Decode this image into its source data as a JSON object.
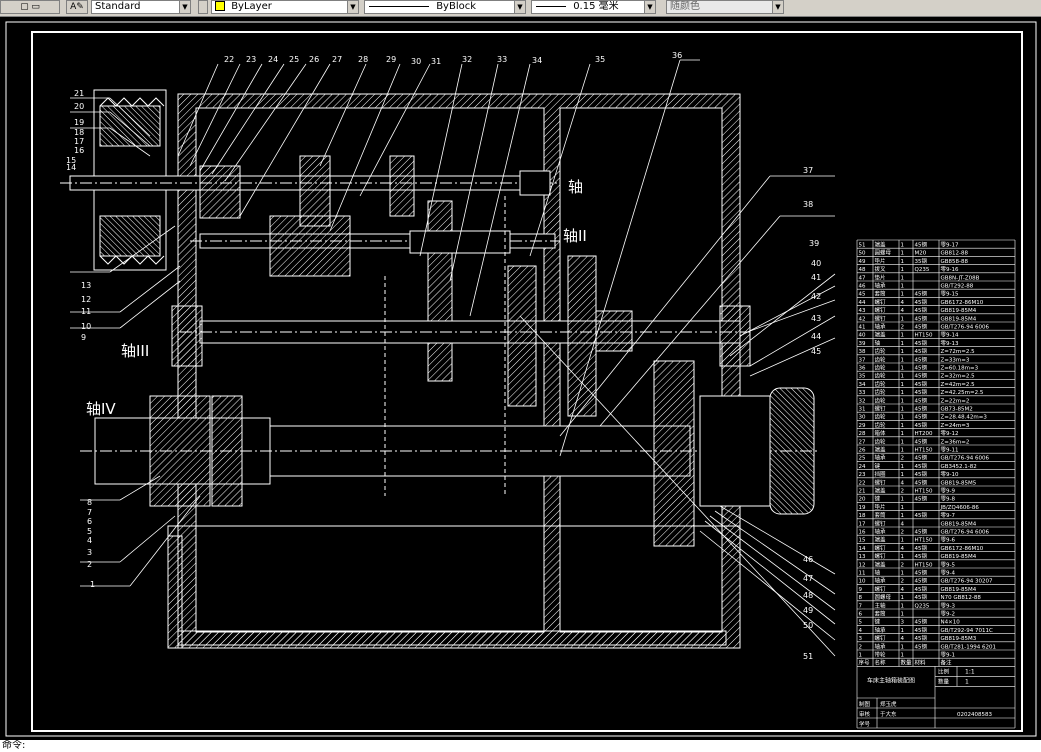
{
  "toolbar": {
    "textstyle": "Standard",
    "layer": "ByLayer",
    "linetype": "ByBlock",
    "lineweight": "0.15 毫米",
    "plotstyle": "随颜色"
  },
  "drawing": {
    "shaft_labels": {
      "I": "轴",
      "II": "轴II",
      "III": "轴III",
      "IV": "轴IV"
    },
    "callouts_top": [
      "22",
      "23",
      "24",
      "25",
      "26",
      "27",
      "28",
      "29",
      "30",
      "31",
      "32",
      "33",
      "34",
      "35",
      "36"
    ],
    "callouts_left": [
      "21",
      "20",
      "19",
      "18",
      "17",
      "16",
      "15",
      "14",
      "13",
      "12",
      "11",
      "10",
      "9",
      "8",
      "7",
      "6",
      "5",
      "4",
      "3",
      "2",
      "1"
    ],
    "callouts_right": [
      "37",
      "38",
      "39",
      "40",
      "41",
      "42",
      "43",
      "44",
      "45",
      "46",
      "47",
      "48",
      "49",
      "50",
      "51"
    ]
  },
  "parts_table": {
    "rows": [
      {
        "no": "51",
        "name": "端盖",
        "qty": "1",
        "mat": "45钢",
        "std": "零9-17"
      },
      {
        "no": "50",
        "name": "圆螺母",
        "qty": "1",
        "mat": "M20",
        "std": "GB812-88"
      },
      {
        "no": "49",
        "name": "垫片",
        "qty": "1",
        "mat": "35钢",
        "std": "GB858-88"
      },
      {
        "no": "48",
        "name": "拨叉",
        "qty": "1",
        "mat": "Q235",
        "std": "零9-16"
      },
      {
        "no": "47",
        "name": "垫片",
        "qty": "1",
        "mat": "",
        "std": "GB8N-JT-Z08B"
      },
      {
        "no": "46",
        "name": "轴承",
        "qty": "1",
        "mat": "",
        "std": "GB/T292-88"
      },
      {
        "no": "45",
        "name": "套筒",
        "qty": "1",
        "mat": "45钢",
        "std": "零9-15"
      },
      {
        "no": "44",
        "name": "螺钉",
        "qty": "4",
        "mat": "45钢",
        "std": "GB6172-86M10"
      },
      {
        "no": "43",
        "name": "螺钉",
        "qty": "4",
        "mat": "45钢",
        "std": "GB819-85M4"
      },
      {
        "no": "42",
        "name": "螺钉",
        "qty": "1",
        "mat": "45钢",
        "std": "GB819-85M4"
      },
      {
        "no": "41",
        "name": "轴承",
        "qty": "2",
        "mat": "45钢",
        "std": "GB/T276-94 6006"
      },
      {
        "no": "40",
        "name": "端盖",
        "qty": "1",
        "mat": "HT150",
        "std": "零9-14"
      },
      {
        "no": "39",
        "name": "轴",
        "qty": "1",
        "mat": "45钢",
        "std": "零9-13"
      },
      {
        "no": "38",
        "name": "齿轮",
        "qty": "1",
        "mat": "45钢",
        "std": "Z=72m=2.5"
      },
      {
        "no": "37",
        "name": "齿轮",
        "qty": "1",
        "mat": "45钢",
        "std": "Z=33m=3"
      },
      {
        "no": "36",
        "name": "齿轮",
        "qty": "1",
        "mat": "45钢",
        "std": "Z=60.18m=3"
      },
      {
        "no": "35",
        "name": "齿轮",
        "qty": "1",
        "mat": "45钢",
        "std": "Z=32m=2.5"
      },
      {
        "no": "34",
        "name": "齿轮",
        "qty": "1",
        "mat": "45钢",
        "std": "Z=42m=2.5"
      },
      {
        "no": "33",
        "name": "齿轮",
        "qty": "1",
        "mat": "45钢",
        "std": "Z=42.25m=2.5"
      },
      {
        "no": "32",
        "name": "齿轮",
        "qty": "1",
        "mat": "45钢",
        "std": "Z=22m=2"
      },
      {
        "no": "31",
        "name": "螺钉",
        "qty": "1",
        "mat": "45钢",
        "std": "GB73-85M2"
      },
      {
        "no": "30",
        "name": "齿轮",
        "qty": "1",
        "mat": "45钢",
        "std": "Z=28.48.42m=3"
      },
      {
        "no": "29",
        "name": "齿轮",
        "qty": "1",
        "mat": "45钢",
        "std": "Z=24m=3"
      },
      {
        "no": "28",
        "name": "箱体",
        "qty": "1",
        "mat": "HT200",
        "std": "零9-12"
      },
      {
        "no": "27",
        "name": "齿轮",
        "qty": "1",
        "mat": "45钢",
        "std": "Z=36m=2"
      },
      {
        "no": "26",
        "name": "端盖",
        "qty": "1",
        "mat": "HT150",
        "std": "零9-11"
      },
      {
        "no": "25",
        "name": "轴承",
        "qty": "2",
        "mat": "45钢",
        "std": "GB/T276-94 6006"
      },
      {
        "no": "24",
        "name": "键",
        "qty": "1",
        "mat": "45钢",
        "std": "GB3452.1-82"
      },
      {
        "no": "23",
        "name": "挡圈",
        "qty": "1",
        "mat": "45钢",
        "std": "零9-10"
      },
      {
        "no": "22",
        "name": "螺钉",
        "qty": "4",
        "mat": "45钢",
        "std": "GB819-85M5"
      },
      {
        "no": "21",
        "name": "端盖",
        "qty": "2",
        "mat": "HT150",
        "std": "零9-9"
      },
      {
        "no": "20",
        "name": "键",
        "qty": "1",
        "mat": "45钢",
        "std": "零9-8"
      },
      {
        "no": "19",
        "name": "垫片",
        "qty": "1",
        "mat": "",
        "std": "JB/ZQ4606-86"
      },
      {
        "no": "18",
        "name": "套筒",
        "qty": "1",
        "mat": "45钢",
        "std": "零9-7"
      },
      {
        "no": "17",
        "name": "螺钉",
        "qty": "4",
        "mat": "",
        "std": "GB819-85M4"
      },
      {
        "no": "16",
        "name": "轴承",
        "qty": "2",
        "mat": "45钢",
        "std": "GB/T276-94 6006"
      },
      {
        "no": "15",
        "name": "端盖",
        "qty": "1",
        "mat": "HT150",
        "std": "零9-6"
      },
      {
        "no": "14",
        "name": "螺钉",
        "qty": "4",
        "mat": "45钢",
        "std": "GB6172-86M10"
      },
      {
        "no": "13",
        "name": "螺钉",
        "qty": "1",
        "mat": "45钢",
        "std": "GB819-85M4"
      },
      {
        "no": "12",
        "name": "端盖",
        "qty": "2",
        "mat": "HT150",
        "std": "零9-5"
      },
      {
        "no": "11",
        "name": "轴",
        "qty": "1",
        "mat": "45钢",
        "std": "零9-4"
      },
      {
        "no": "10",
        "name": "轴承",
        "qty": "2",
        "mat": "45钢",
        "std": "GB/T276-94 30207"
      },
      {
        "no": "9",
        "name": "螺钉",
        "qty": "4",
        "mat": "45钢",
        "std": "GB819-85M4"
      },
      {
        "no": "8",
        "name": "圆螺母",
        "qty": "1",
        "mat": "45钢",
        "std": "N70 GB812-88"
      },
      {
        "no": "7",
        "name": "主轴",
        "qty": "1",
        "mat": "Q235",
        "std": "零9-3"
      },
      {
        "no": "6",
        "name": "套筒",
        "qty": "1",
        "mat": "",
        "std": "零9-2"
      },
      {
        "no": "5",
        "name": "键",
        "qty": "3",
        "mat": "45钢",
        "std": "N4×10"
      },
      {
        "no": "4",
        "name": "轴承",
        "qty": "1",
        "mat": "45钢",
        "std": "GB/T292-94 7011C"
      },
      {
        "no": "3",
        "name": "螺钉",
        "qty": "4",
        "mat": "45钢",
        "std": "GB819-85M3"
      },
      {
        "no": "2",
        "name": "轴承",
        "qty": "1",
        "mat": "45钢",
        "std": "GB/T281-1994 6201"
      },
      {
        "no": "1",
        "name": "带轮",
        "qty": "1",
        "mat": "",
        "std": "零9-1"
      }
    ],
    "header": {
      "no": "序号",
      "name": "名称",
      "qty": "数量",
      "mat": "材料",
      "std": "备注"
    },
    "title_block": {
      "title": "车床主轴箱装配图",
      "scale_label": "比例",
      "scale": "1:1",
      "qty_label": "数量",
      "qty": "1",
      "designer_label": "制图",
      "checker_label": "审核",
      "approver_label": "学号",
      "designer": "郑玉虎",
      "checker": "于大东",
      "drawing_no": "0202408583"
    }
  },
  "command_line": {
    "text": "命令:"
  }
}
